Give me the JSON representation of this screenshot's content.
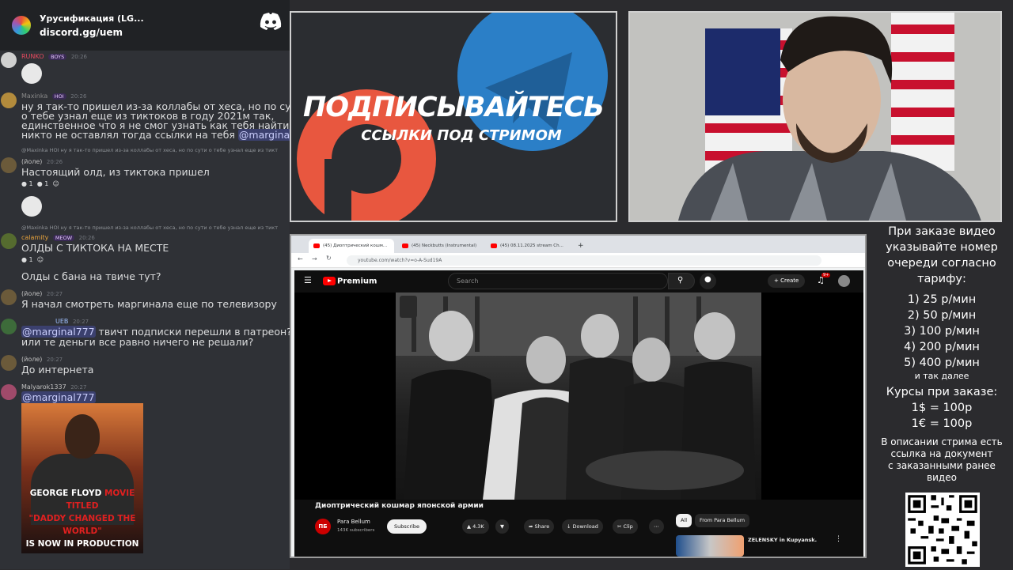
{
  "discord": {
    "server_name": "Урусификация (LG...",
    "invite": "discord.gg/uem",
    "messages": [
      {
        "author": "RUNKO",
        "badge": "BOYS",
        "time": "20:26"
      },
      {
        "author": "Maxinka",
        "badge": "HOI",
        "time": "20:26",
        "lines": [
          "ну я так-то пришел из-за коллабы от хеса, но по сути",
          "о тебе узнал еще из тиктоков в году 2021м так,",
          "единственное что я не смог узнать как тебя найти ибо",
          "никто не оставлял тогда ссылки на тебя"
        ],
        "mention": "@marginal777"
      },
      {
        "reply": "@Maxinka  HOI  ну я так-то пришел из-за коллабы от хеса, но по сути о тебе узнал еще из тикт",
        "author": "(йоле)",
        "time": "20:26",
        "text": "Настоящий олд, из тиктока пришел",
        "reactions": [
          "1",
          "1"
        ]
      },
      {
        "reply": "@Maxinka  HOI  ну я так-то пришел из-за коллабы от хеса, но по сути о тебе узнал еще из тикт",
        "author": "calamity",
        "badge": "MEOW",
        "time": "20:26",
        "text": "ОЛДЫ С ТИКТОКА НА МЕСТЕ",
        "reactions": [
          "1"
        ]
      },
      {
        "text": "Олды с бана на твиче тут?"
      },
      {
        "author": "(йоле)",
        "time": "20:27",
        "text": "Я начал смотреть маргинала еще по телевизору"
      },
      {
        "author": "UEB",
        "time": "20:27",
        "mention": "@marginal777",
        "text": " твичт подписки перешли в патреон?",
        "text2": "или те деньги все равно ничего не решали?"
      },
      {
        "author": "(йоле)",
        "time": "20:27",
        "text": "До интернета"
      },
      {
        "author": "Malyarok1337",
        "time": "20:27",
        "mention": "@marginal777"
      }
    ],
    "meme_text": [
      "GEORGE FLOYD",
      "MOVIE TITLED",
      "\"DADDY CHANGED THE WORLD\"",
      "IS NOW IN PRODUCTION"
    ]
  },
  "banner": {
    "title": "ПОДПИСЫВАЙТЕСЬ",
    "subtitle": "ССЫЛКИ ПОД СТРИМОМ"
  },
  "browser": {
    "tabs": [
      "(45) Диоптрический кошм...",
      "(45) Neckbutts (Instrumental)",
      "(45) 08.11.2025 stream Ch..."
    ],
    "url": "youtube.com/watch?v=o-A-Sud19A",
    "youtube": {
      "logo": "Premium",
      "search_placeholder": "Search",
      "create": "Create",
      "notifications": "9+",
      "title": "Диоптрический кошмар японской армии",
      "channel": "Para Bellum",
      "channel_initials": "ПБ",
      "subscribers": "143K subscribers",
      "subscribe": "Subscribe",
      "likes": "4.3K",
      "share": "Share",
      "download": "Download",
      "clip": "Clip",
      "chips": [
        "All",
        "From Para Bellum"
      ],
      "rec_title": "ZELENSKY in Kupyansk."
    }
  },
  "prices": {
    "heading": [
      "При заказе видео",
      "указывайте номер",
      "очереди согласно",
      "тарифу:"
    ],
    "tiers": [
      "1) 25 р/мин",
      "2) 50 р/мин",
      "3) 100 р/мин",
      "4) 200 р/мин",
      "5) 400 р/мин"
    ],
    "etc": "и так далее",
    "rates_title": "Курсы при заказе:",
    "rates": [
      "1$ = 100р",
      "1€ = 100р"
    ],
    "note": [
      "В описании стрима есть",
      "ссылка на документ",
      "с заказанными ранее",
      "видео"
    ]
  },
  "colors": {
    "discord_bg": "#2f3136",
    "youtube_red": "#ff0000",
    "mention": "#c9cdfb"
  }
}
